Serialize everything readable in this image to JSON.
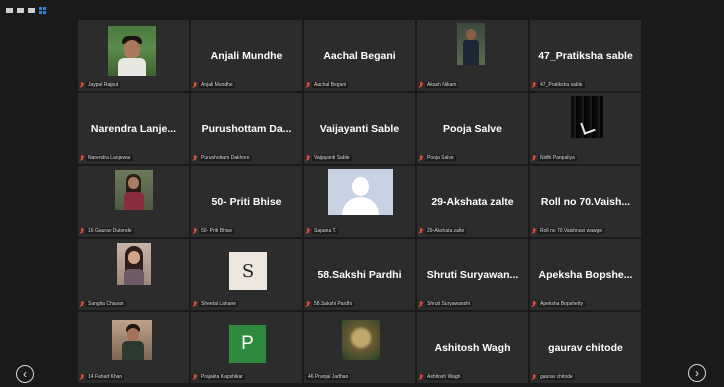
{
  "toolbar": {
    "icons": [
      "minimize-icon",
      "window-icon",
      "list-view-icon",
      "gallery-view-icon"
    ]
  },
  "tiles": [
    {
      "display": "",
      "footer": "Jaypal Rajput",
      "thumb": "face"
    },
    {
      "display": "Anjali Mundhe",
      "footer": "Anjali Mundhe",
      "thumb": ""
    },
    {
      "display": "Aachal Begani",
      "footer": "Aachal Begani",
      "thumb": ""
    },
    {
      "display": "",
      "footer": "Akash Nikam",
      "thumb": "person"
    },
    {
      "display": "47_Pratiksha sable",
      "footer": "47_Pratiksha sable",
      "thumb": ""
    },
    {
      "display": "Narendra Lanje...",
      "footer": "Narendra Lanjewar",
      "thumb": ""
    },
    {
      "display": "Purushottam Da...",
      "footer": "Purushottam Dakhore",
      "thumb": ""
    },
    {
      "display": "Vaijayanti Sable",
      "footer": "Vaijayanti Sable",
      "thumb": ""
    },
    {
      "display": "Pooja Salve",
      "footer": "Pooja Salve",
      "thumb": ""
    },
    {
      "display": "",
      "footer": "Nidhi Panpaliya",
      "thumb": "dark"
    },
    {
      "display": "",
      "footer": "16 Gaurav Dutonde",
      "thumb": "girl1"
    },
    {
      "display": "50- Priti Bhise",
      "footer": "50- Priti Bhise",
      "thumb": ""
    },
    {
      "display": "",
      "footer": "Sapana T.",
      "thumb": "avatar"
    },
    {
      "display": "29-Akshata zalte",
      "footer": "29-Akshata zalte",
      "thumb": ""
    },
    {
      "display": "Roll no 70.Vaish...",
      "footer": "Roll no 70.Vaishnavi wawge",
      "thumb": ""
    },
    {
      "display": "",
      "footer": "Sangita Chavan",
      "thumb": "girl2"
    },
    {
      "display": "",
      "footer": "Sheetal Lahane",
      "thumb": "letter-s",
      "letter": "S"
    },
    {
      "display": "58.Sakshi Pardhi",
      "footer": "58.Sakshi Pardhi",
      "thumb": ""
    },
    {
      "display": "Shruti Suryawan...",
      "footer": "Shruti Suryawanshi",
      "thumb": ""
    },
    {
      "display": "Apeksha Bopshe...",
      "footer": "Apeksha Bopshetty",
      "thumb": ""
    },
    {
      "display": "",
      "footer": "14 Fahad Khan",
      "thumb": "boy2"
    },
    {
      "display": "",
      "footer": "Prajakta Kapshikar",
      "thumb": "letter-p",
      "letter": "P"
    },
    {
      "display": "",
      "footer": "46 Pranjal Jadhao",
      "thumb": "scene",
      "muted": false
    },
    {
      "display": "Ashitosh Wagh",
      "footer": "Ashitosh Wagh",
      "thumb": ""
    },
    {
      "display": "gaurav chitode",
      "footer": "gaurav chitode",
      "thumb": ""
    }
  ],
  "nav": {
    "prev": "‹",
    "next": "›"
  },
  "colors": {
    "background": "#1a1a1a",
    "tile": "#2c2c2c",
    "muted_mic": "#e04a3a",
    "view_accent": "#2f86d6"
  }
}
